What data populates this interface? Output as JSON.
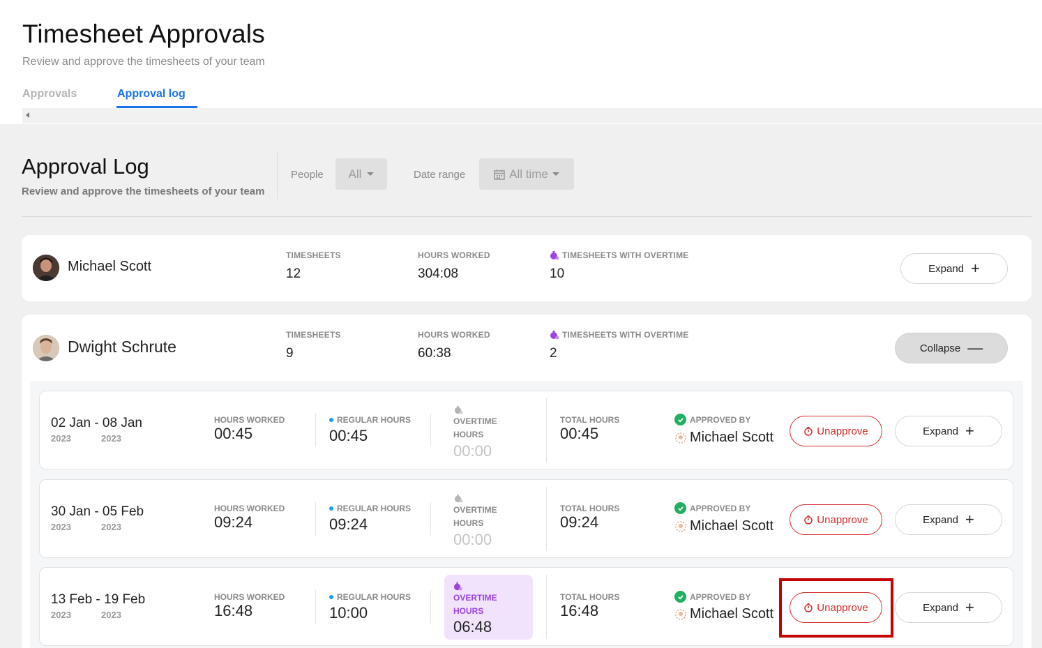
{
  "header": {
    "title": "Timesheet Approvals",
    "subtitle": "Review and approve the timesheets of your team",
    "tabs": [
      {
        "label": "Approvals"
      },
      {
        "label": "Approval log"
      }
    ]
  },
  "log": {
    "title": "Approval Log",
    "subtitle": "Review and approve the timesheets of your team",
    "filters": {
      "people_label": "People",
      "people_value": "All",
      "date_label": "Date range",
      "date_value": "All time"
    }
  },
  "labels": {
    "timesheets": "TIMESHEETS",
    "hours_worked": "HOURS WORKED",
    "timesheets_overtime": "TIMESHEETS WITH OVERTIME",
    "regular_hours": "REGULAR HOURS",
    "overtime": "OVERTIME",
    "hours": "HOURS",
    "total_hours": "TOTAL HOURS",
    "approved_by": "APPROVED BY",
    "unapprove": "Unapprove",
    "expand": "Expand",
    "collapse": "Collapse"
  },
  "people": [
    {
      "name": "Michael Scott",
      "timesheets": "12",
      "hours_worked": "304:08",
      "overtime_timesheets": "10",
      "action": "Expand"
    },
    {
      "name": "Dwight Schrute",
      "timesheets": "9",
      "hours_worked": "60:38",
      "overtime_timesheets": "2",
      "action": "Collapse"
    }
  ],
  "timesheets": [
    {
      "range": "02 Jan - 08 Jan",
      "year_start": "2023",
      "year_end": "2023",
      "hours_worked": "00:45",
      "regular_hours": "00:45",
      "overtime_hours": "00:00",
      "total_hours": "00:45",
      "approver": "Michael Scott"
    },
    {
      "range": "30 Jan - 05 Feb",
      "year_start": "2023",
      "year_end": "2023",
      "hours_worked": "09:24",
      "regular_hours": "09:24",
      "overtime_hours": "00:00",
      "total_hours": "09:24",
      "approver": "Michael Scott"
    },
    {
      "range": "13 Feb - 19 Feb",
      "year_start": "2023",
      "year_end": "2023",
      "hours_worked": "16:48",
      "regular_hours": "10:00",
      "overtime_hours": "06:48",
      "total_hours": "16:48",
      "approver": "Michael Scott"
    }
  ],
  "colors": {
    "accent": "#1a73e8",
    "danger": "#d32f2f",
    "overtime": "#9b45e0",
    "approved": "#23b05e"
  }
}
